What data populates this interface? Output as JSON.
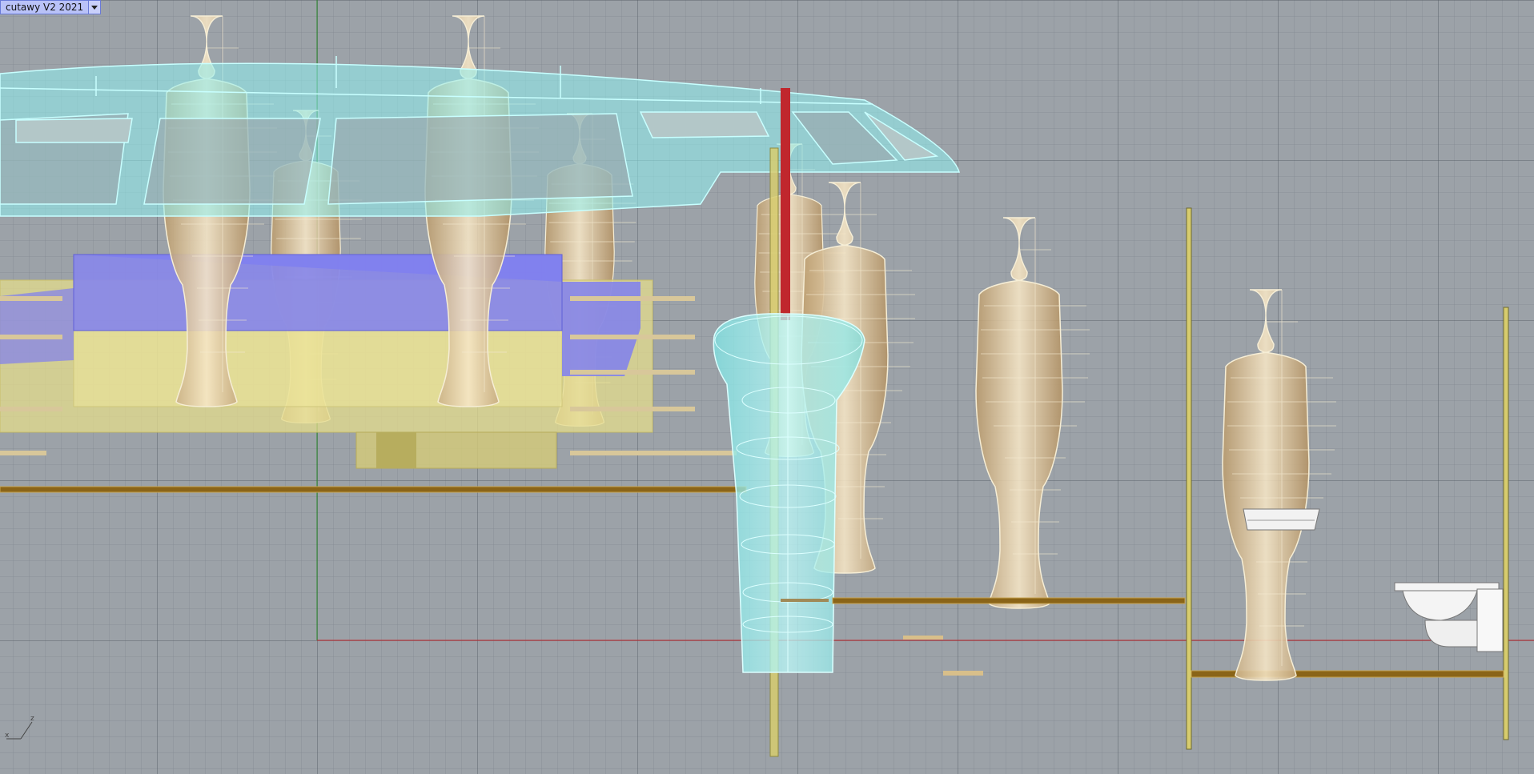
{
  "viewport": {
    "title": "cutawy V2 2021",
    "menu_icon": "chevron-down-icon"
  },
  "axis_widget": {
    "x_label": "x",
    "z_label": "z"
  },
  "colors": {
    "background": "#9ca2a8",
    "mannequin": "#d9bf94",
    "glass_cyan": "#8ff0f0",
    "seat_yellow": "#e4dc8c",
    "seat_blue": "#7f7ff0",
    "floor_bronze": "#8a6418",
    "red_axis": "#c0272d",
    "green_axis": "#2a8a2a",
    "vp_tab_bg": "#b9c2f8"
  }
}
